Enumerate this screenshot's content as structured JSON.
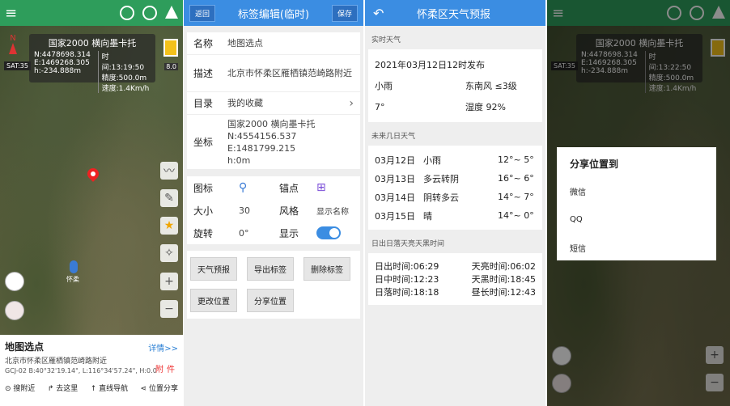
{
  "map": {
    "coord_title": "国家2000  横向墨卡托",
    "n": "N:4478698.314",
    "e": "E:1469268.305",
    "h": "h:-234.888m",
    "time1": "时间:13:19:50",
    "time2": "时间:13:22:50",
    "accuracy": "精度:500.0m",
    "speed": "速度:1.4Km/h",
    "compass_n": "N",
    "sat": "SAT:35",
    "zoom": "8.0",
    "place_label": "怀柔",
    "info_title": "地图选点",
    "info_detail": "详情>>",
    "info_address": "北京市怀柔区雁栖镇范崎路附近",
    "info_coord": "GCJ-02  B:40°32'19.14\", L:116°34'57.24\", H:0.0",
    "info_attach": "附件",
    "actions": [
      "搜附近",
      "去这里",
      "直线导航",
      "位置分享"
    ]
  },
  "editor": {
    "back": "返回",
    "title": "标签编辑(临时)",
    "save": "保存",
    "name_key": "名称",
    "name_val": "地图选点",
    "desc_key": "描述",
    "desc_val": "北京市怀柔区雁栖镇范崎路附近",
    "dir_key": "目录",
    "dir_val": "我的收藏",
    "coord_key": "坐标",
    "coord_l1": "国家2000  横向墨卡托",
    "coord_l2": "N:4554156.537",
    "coord_l3": "E:1481799.215",
    "coord_l4": "h:0m",
    "icon_key": "图标",
    "anchor_key": "锚点",
    "size_key": "大小",
    "size_val": "30",
    "style_key": "风格",
    "style_val": "显示名称",
    "rotate_key": "旋转",
    "rotate_val": "0°",
    "show_key": "显示",
    "buttons": [
      "天气预报",
      "导出标签",
      "删除标签",
      "更改位置",
      "分享位置"
    ]
  },
  "weather": {
    "title": "怀柔区天气预报",
    "realtime_label": "实时天气",
    "published": "2021年03月12日12时发布",
    "condition": "小雨",
    "wind": "东南风   ≤3级",
    "temp": "7°",
    "humidity": "湿度   92%",
    "forecast_label": "未来几日天气",
    "forecast": [
      {
        "date": "03月12日",
        "weather": "小雨",
        "temp": "12°~ 5°"
      },
      {
        "date": "03月13日",
        "weather": "多云转阴",
        "temp": "16°~ 6°"
      },
      {
        "date": "03月14日",
        "weather": "阴转多云",
        "temp": "14°~ 7°"
      },
      {
        "date": "03月15日",
        "weather": "晴",
        "temp": "14°~ 0°"
      }
    ],
    "sun_label": "日出日落天亮天黑时间",
    "sunrise": "日出时间:06:29",
    "dawn": "天亮时间:06:02",
    "noon": "日中时间:12:23",
    "dusk": "天黑时间:18:45",
    "sunset": "日落时间:18:18",
    "daylength": "昼长时间:12:43"
  },
  "share": {
    "title": "分享位置到",
    "options": [
      "微信",
      "QQ",
      "短信"
    ]
  }
}
